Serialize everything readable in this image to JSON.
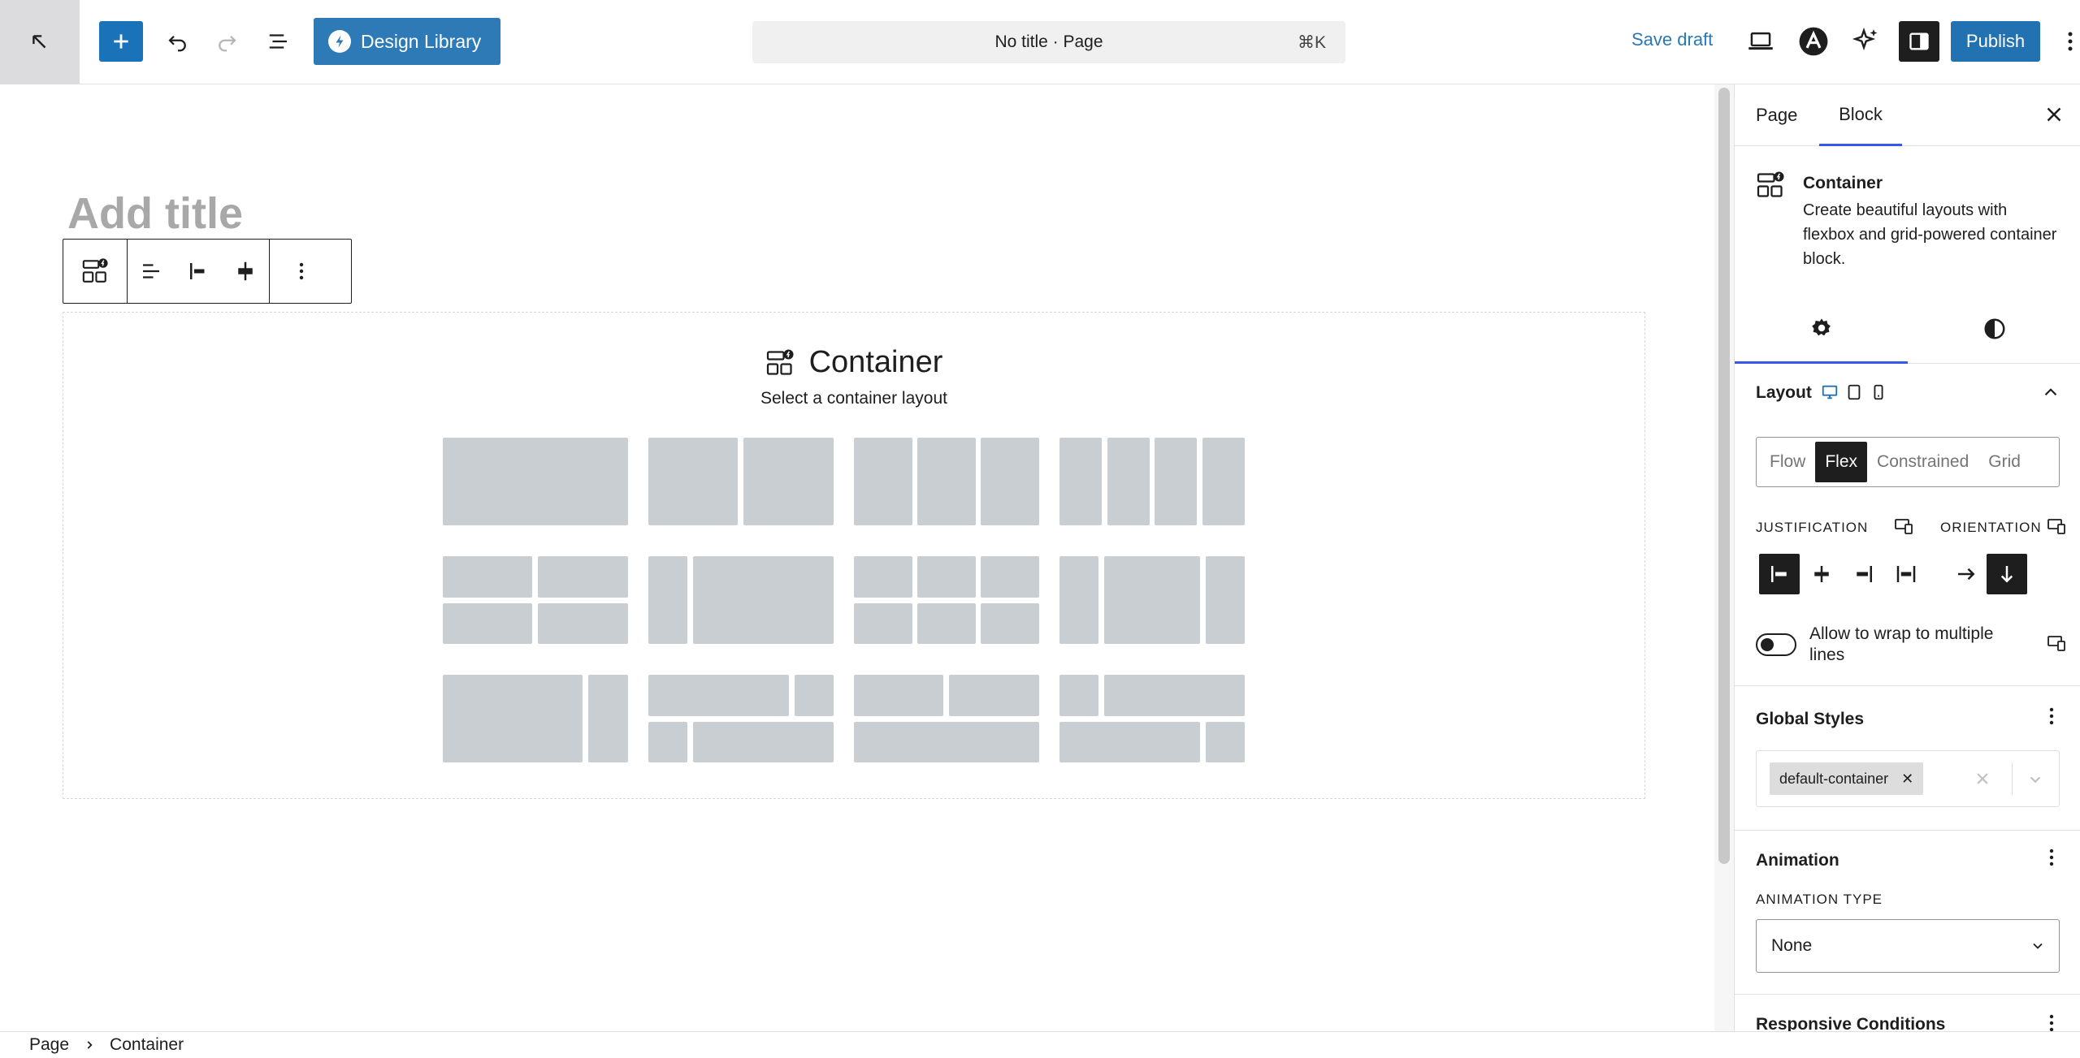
{
  "header": {
    "design_library_label": "Design Library",
    "doc_title": "No title · Page",
    "shortcut": "⌘K",
    "save_draft": "Save draft",
    "publish": "Publish"
  },
  "editor": {
    "title_placeholder": "Add title",
    "container": {
      "heading": "Container",
      "subtitle": "Select a container layout"
    }
  },
  "sidebar": {
    "tabs": [
      "Page",
      "Block"
    ],
    "active_tab": "Block",
    "block_card": {
      "title": "Container",
      "description": "Create beautiful layouts with flexbox and grid-powered container block."
    },
    "layout": {
      "title": "Layout",
      "types": [
        "Flow",
        "Flex",
        "Constrained",
        "Grid"
      ],
      "active_type": "Flex",
      "justification_label": "JUSTIFICATION",
      "orientation_label": "ORIENTATION",
      "wrap_label": "Allow to wrap to multiple lines",
      "wrap_enabled": false
    },
    "global_styles": {
      "title": "Global Styles",
      "token": "default-container"
    },
    "animation": {
      "title": "Animation",
      "type_label": "ANIMATION TYPE",
      "type_value": "None"
    },
    "responsive_title": "Responsive Conditions"
  },
  "breadcrumb": [
    "Page",
    "Container"
  ],
  "colors": {
    "accent": "#2271b1",
    "design_library": "#2e7ab6",
    "layout_tile": "#c9ced3",
    "tab_indicator": "#3858e9"
  }
}
